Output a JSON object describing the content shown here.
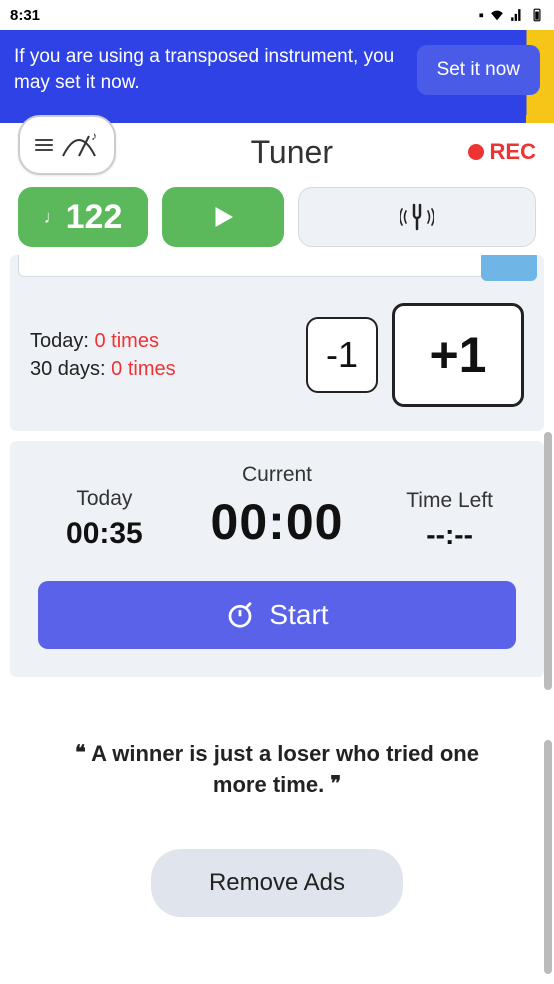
{
  "status": {
    "time": "8:31"
  },
  "banner": {
    "text": "If you are using a transposed instrument, you may set it now.",
    "button": "Set it now"
  },
  "header": {
    "title": "Tuner",
    "rec": "REC"
  },
  "controls": {
    "bpm": "122"
  },
  "practice": {
    "today_label": "Today:",
    "today_value": "0 times",
    "range_label": "30 days:",
    "range_value": "0 times",
    "minus": "-1",
    "plus": "+1"
  },
  "timer": {
    "today_label": "Today",
    "today_value": "00:35",
    "current_label": "Current",
    "current_value": "00:00",
    "left_label": "Time Left",
    "left_value": "--:--",
    "start": "Start"
  },
  "quote": "A winner is just a loser who tried one more time.",
  "remove_ads": "Remove Ads"
}
